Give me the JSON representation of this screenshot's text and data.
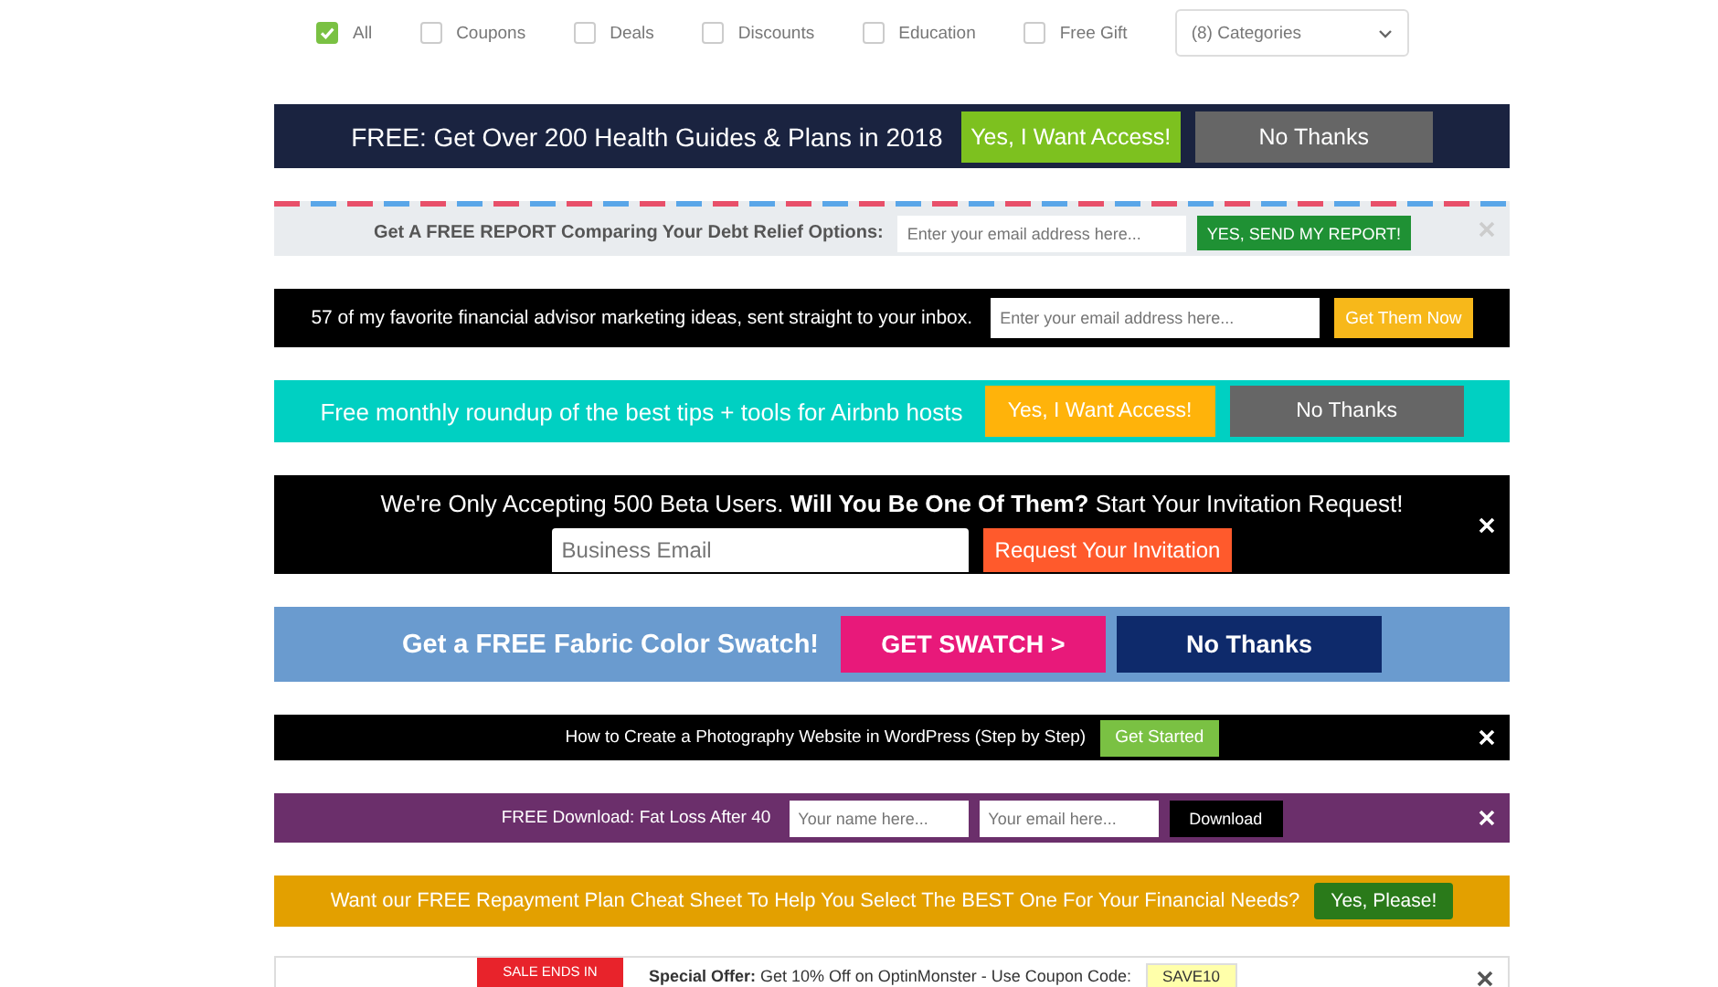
{
  "filters": [
    {
      "label": "All",
      "checked": true
    },
    {
      "label": "Coupons",
      "checked": false
    },
    {
      "label": "Deals",
      "checked": false
    },
    {
      "label": "Discounts",
      "checked": false
    },
    {
      "label": "Education",
      "checked": false
    },
    {
      "label": "Free Gift",
      "checked": false
    }
  ],
  "category_select": {
    "value": "(8) Categories"
  },
  "banners": [
    {
      "parts": [
        {
          "kind": "text",
          "text": "FREE: Get Over 200 Health Guides & Plans  in 2018"
        },
        {
          "kind": "button",
          "label": "Yes, I Want Access!"
        },
        {
          "kind": "button",
          "label": "No Thanks"
        }
      ]
    },
    {
      "parts": [
        {
          "kind": "text",
          "text": "Get A FREE REPORT Comparing Your Debt Relief Options:"
        },
        {
          "kind": "input",
          "placeholder": "Enter your email address here..."
        },
        {
          "kind": "button",
          "label": "YES, SEND MY REPORT!"
        },
        {
          "kind": "close"
        }
      ]
    },
    {
      "parts": [
        {
          "kind": "text",
          "text": "57 of my favorite financial advisor marketing ideas, sent straight to your inbox."
        },
        {
          "kind": "input",
          "placeholder": "Enter your email address here..."
        },
        {
          "kind": "button",
          "label": "Get Them Now"
        }
      ]
    },
    {
      "parts": [
        {
          "kind": "text",
          "text": "Free monthly roundup of the best tips + tools for Airbnb hosts"
        },
        {
          "kind": "button",
          "label": "Yes, I Want Access!"
        },
        {
          "kind": "button",
          "label": "No Thanks"
        }
      ]
    },
    {
      "parts": [
        {
          "kind": "text",
          "text": "We're Only Accepting 500 Beta Users. **Will You Be One Of Them?** Start Your Invitation Request!"
        },
        {
          "kind": "input",
          "placeholder": "Business Email"
        },
        {
          "kind": "button",
          "label": "Request Your Invitation"
        },
        {
          "kind": "close"
        }
      ]
    },
    {
      "parts": [
        {
          "kind": "text",
          "text": "Get a FREE Fabric Color Swatch!"
        },
        {
          "kind": "button",
          "label": "GET SWATCH >"
        },
        {
          "kind": "button",
          "label": "No Thanks"
        }
      ]
    },
    {
      "parts": [
        {
          "kind": "text",
          "text": "How to Create a Photography Website in WordPress (Step by Step)"
        },
        {
          "kind": "button",
          "label": "Get Started"
        },
        {
          "kind": "close"
        }
      ]
    },
    {
      "parts": [
        {
          "kind": "text",
          "text": "FREE Download: Fat Loss After 40"
        },
        {
          "kind": "input",
          "placeholder": "Your name here..."
        },
        {
          "kind": "input",
          "placeholder": "Your email here..."
        },
        {
          "kind": "button",
          "label": "Download"
        },
        {
          "kind": "close"
        }
      ]
    },
    {
      "parts": [
        {
          "kind": "text",
          "text": "Want our FREE Repayment Plan Cheat Sheet To Help You Select The BEST One For Your Financial Needs?"
        },
        {
          "kind": "button",
          "label": "Yes, Please!"
        }
      ]
    },
    {
      "parts": [
        {
          "kind": "badge",
          "text": "SALE ENDS IN"
        },
        {
          "kind": "text",
          "text": "**Special Offer:** Get 10% Off on OptinMonster - Use Coupon Code:"
        },
        {
          "kind": "coupon",
          "text": "SAVE10"
        },
        {
          "kind": "close"
        }
      ]
    }
  ]
}
